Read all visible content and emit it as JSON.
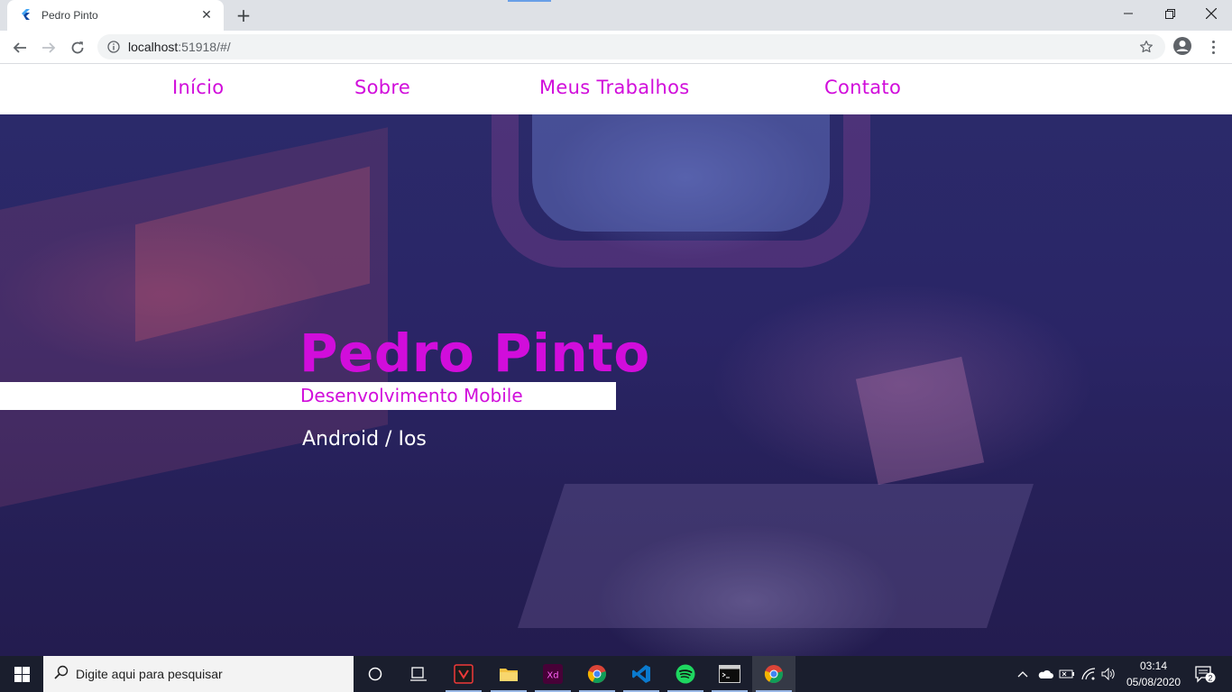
{
  "browser": {
    "tab_title": "Pedro Pinto",
    "url_host": "localhost",
    "url_rest": ":51918/#/",
    "icons": [
      "flutter-icon",
      "close-icon",
      "plus-icon",
      "back-icon",
      "forward-icon",
      "reload-icon",
      "info-icon",
      "star-icon",
      "account-icon",
      "menu-icon",
      "minimize-icon",
      "maximize-icon",
      "close-window-icon"
    ]
  },
  "nav": {
    "items": [
      {
        "label": "Início"
      },
      {
        "label": "Sobre"
      },
      {
        "label": "Meus Trabalhos"
      },
      {
        "label": "Contato"
      }
    ]
  },
  "hero": {
    "name": "Pedro Pinto",
    "subtitle": "Desenvolvimento Mobile",
    "platforms": "Android / Ios"
  },
  "taskbar": {
    "search_placeholder": "Digite aqui para pesquisar",
    "xd_label": "Xd",
    "time": "03:14",
    "date": "05/08/2020",
    "notification_count": "2",
    "apps": [
      "cortana-icon",
      "task-view-icon",
      "vivaldi-icon",
      "file-explorer-icon",
      "adobe-xd-icon",
      "chrome-icon",
      "vscode-icon",
      "spotify-icon",
      "terminal-icon",
      "chrome-icon"
    ]
  },
  "colors": {
    "brand": "#d10ddb",
    "hero_bg": "#2a2566",
    "taskbar": "#1a1e2d"
  }
}
